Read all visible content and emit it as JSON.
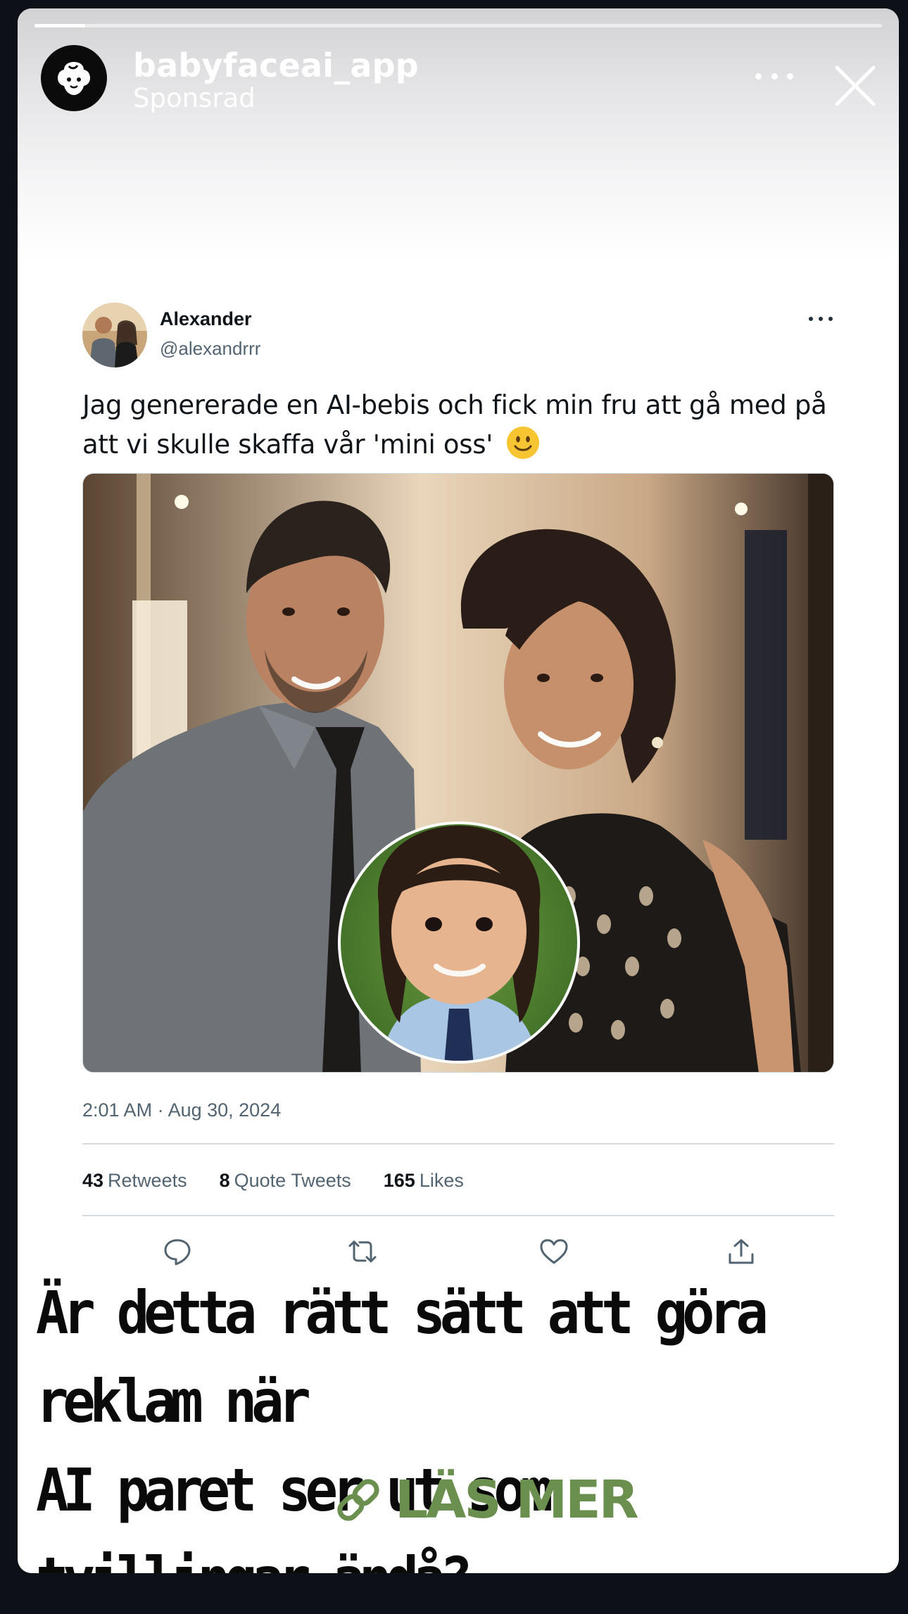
{
  "story": {
    "progress": 0.06,
    "username": "babyfaceai_app",
    "sponsored_label": "Sponsrad"
  },
  "tweet": {
    "name": "Alexander",
    "handle": "@alexandrrr",
    "text": "Jag genererade en AI-bebis och fick min fru att gå med på att vi skulle skaffa vår 'mini oss'",
    "timestamp": "2:01 AM · Aug 30, 2024",
    "stats": [
      {
        "count": "43",
        "label": "Retweets"
      },
      {
        "count": "8",
        "label": "Quote Tweets"
      },
      {
        "count": "165",
        "label": "Likes"
      }
    ],
    "actions": [
      "reply-icon",
      "retweet-icon",
      "like-icon",
      "share-icon"
    ]
  },
  "caption": {
    "line1": "Är detta rätt sätt att göra reklam när",
    "line2": "AI paret ser ut som tvillingar ändå?"
  },
  "cta": {
    "label": "LÄS MER",
    "color": "#6b8f4e",
    "icon": "link-icon"
  }
}
